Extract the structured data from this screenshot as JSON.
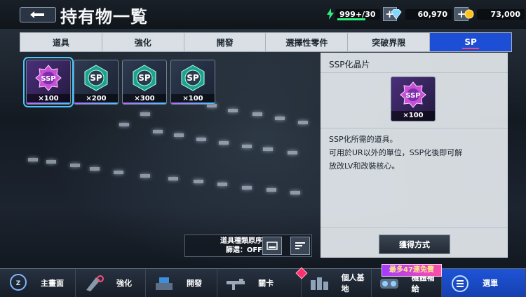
{
  "header": {
    "title": "持有物一覧",
    "energy": "999+/30",
    "gems": "60,970",
    "coins": "73,000",
    "colors": {
      "energy": "#2ef07a",
      "gem": "#7fd6ff",
      "coin": "#ffc21a"
    }
  },
  "tabs": [
    {
      "label": "道具",
      "active": false
    },
    {
      "label": "強化",
      "active": false
    },
    {
      "label": "開發",
      "active": false
    },
    {
      "label": "選擇性零件",
      "active": false
    },
    {
      "label": "突破界限",
      "active": false
    },
    {
      "label": "SP",
      "active": true
    }
  ],
  "items": [
    {
      "emblem": "SSP",
      "count": "×100",
      "selected": true
    },
    {
      "emblem": "SP",
      "count": "×200",
      "selected": false
    },
    {
      "emblem": "SP",
      "count": "×300",
      "selected": false
    },
    {
      "emblem": "SP",
      "count": "×100",
      "selected": false
    }
  ],
  "detail": {
    "title": "SSP化晶片",
    "count": "×100",
    "emblem": "SSP",
    "description_lines": [
      "SSP化所需的道具。",
      "可用於UR以外的單位，SSP化後即可解",
      "放改LV和改裝核心。"
    ],
    "obtain_label": "獲得方式"
  },
  "sort": {
    "label_line1": "道具種類原序",
    "label_line2": "篩選：OFF"
  },
  "bottom_nav": [
    {
      "label": "主畫面",
      "icon": "home-icon",
      "active": false
    },
    {
      "label": "強化",
      "icon": "wrench-icon",
      "active": false
    },
    {
      "label": "開發",
      "icon": "develop-icon",
      "active": false
    },
    {
      "label": "關卡",
      "icon": "rifle-icon",
      "active": false
    },
    {
      "label": "個人基地",
      "icon": "base-icon",
      "active": false
    },
    {
      "label": "機體補給",
      "icon": "capsule-icon",
      "active": false
    },
    {
      "label": "選單",
      "icon": "menu-icon",
      "active": true
    }
  ],
  "promo_label": "最多47連免費"
}
